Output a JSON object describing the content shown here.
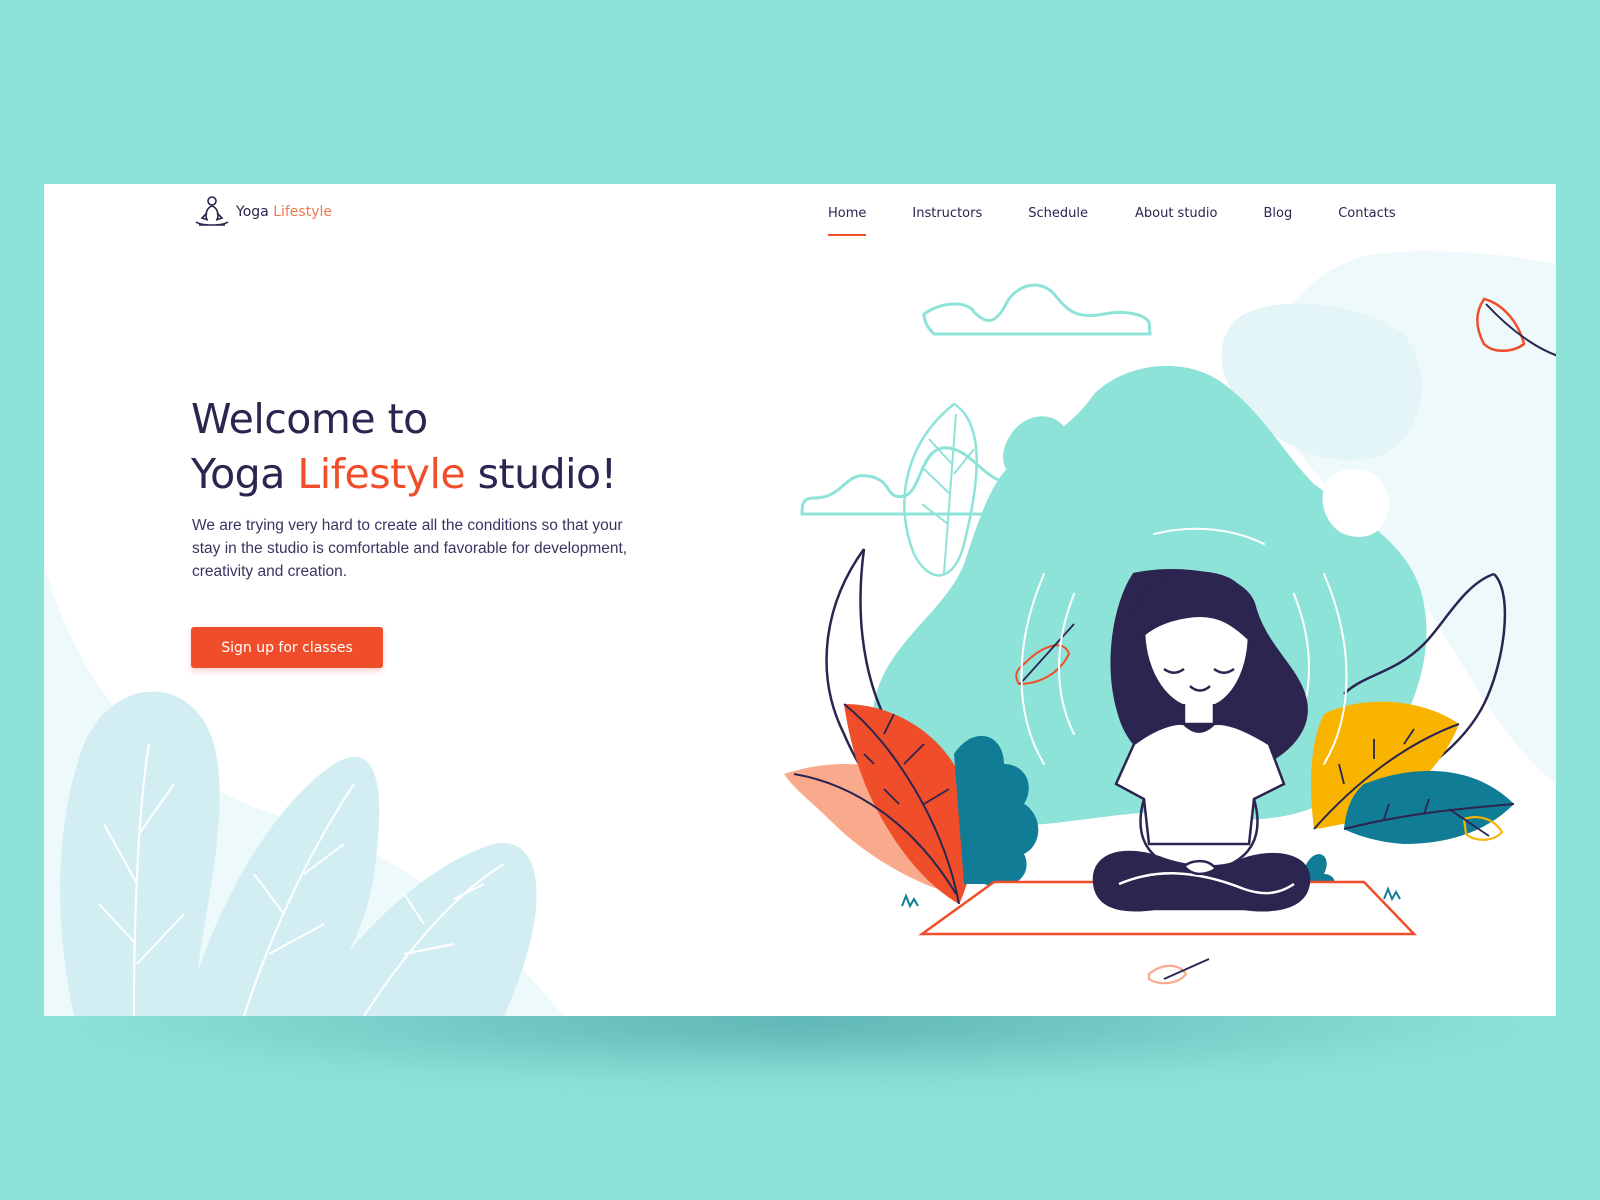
{
  "brand": {
    "name_part1": "Yoga",
    "name_part2": "Lifestyle",
    "logo_icon": "meditation-figure-icon"
  },
  "nav": {
    "items": [
      {
        "label": "Home",
        "active": true
      },
      {
        "label": "Instructors",
        "active": false
      },
      {
        "label": "Schedule",
        "active": false
      },
      {
        "label": "About studio",
        "active": false
      },
      {
        "label": "Blog",
        "active": false
      },
      {
        "label": "Contacts",
        "active": false
      }
    ]
  },
  "hero": {
    "title_line1": "Welcome to",
    "title_line2_part1": "Yoga",
    "title_line2_accent": "Lifestyle",
    "title_line2_part2": "studio!",
    "description": "We are trying very hard to create all the conditions so that your stay in the studio is comfortable and favorable for development, creativity and creation.",
    "cta_label": "Sign up for classes"
  },
  "colors": {
    "page_background": "#8ee3d9",
    "card_background": "#ffffff",
    "text_dark": "#2b2550",
    "accent_orange": "#f04e2b",
    "logo_accent": "#f0794f",
    "teal_blob": "#8ee3d9",
    "light_leaf": "#d3eef2"
  },
  "illustration": {
    "subject": "woman-meditating-illustration",
    "elements": [
      "cloud-outline-icon",
      "leaf-icon",
      "yoga-mat-icon",
      "plant-icon"
    ]
  }
}
